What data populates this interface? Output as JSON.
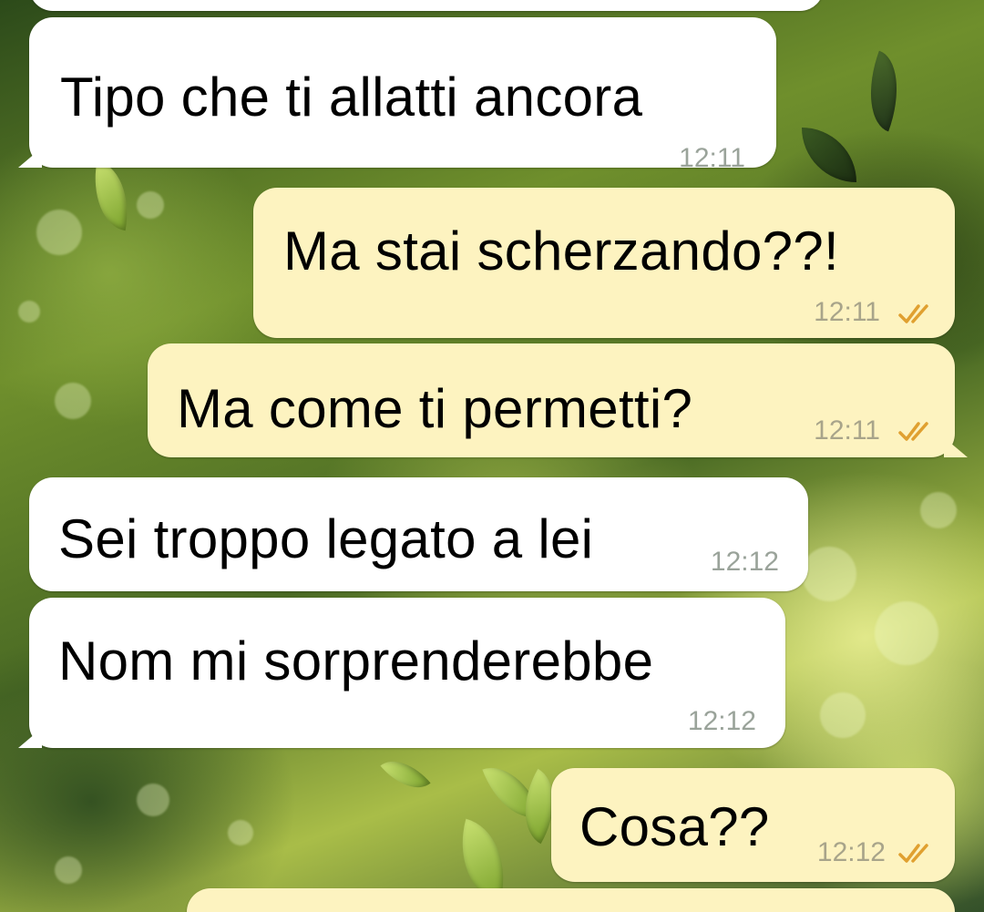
{
  "colors": {
    "incoming_bubble": "#ffffff",
    "outgoing_bubble": "#fdf3c0",
    "timestamp": "#9aa39a",
    "read_ticks": "#e0a030"
  },
  "messages": [
    {
      "direction": "incoming",
      "text": "",
      "time": ""
    },
    {
      "direction": "incoming",
      "text": "Tipo che ti allatti ancora",
      "time": "12:11"
    },
    {
      "direction": "outgoing",
      "text": "Ma stai scherzando??!",
      "time": "12:11",
      "status_icon": "double-check-icon"
    },
    {
      "direction": "outgoing",
      "text": "Ma come ti permetti?",
      "time": "12:11",
      "status_icon": "double-check-icon"
    },
    {
      "direction": "incoming",
      "text": "Sei troppo legato a lei",
      "time": "12:12"
    },
    {
      "direction": "incoming",
      "text": "Nom mi sorprenderebbe",
      "time": "12:12"
    },
    {
      "direction": "outgoing",
      "text": "Cosa??",
      "time": "12:12",
      "status_icon": "double-check-icon"
    },
    {
      "direction": "outgoing",
      "text": "",
      "time": ""
    }
  ]
}
